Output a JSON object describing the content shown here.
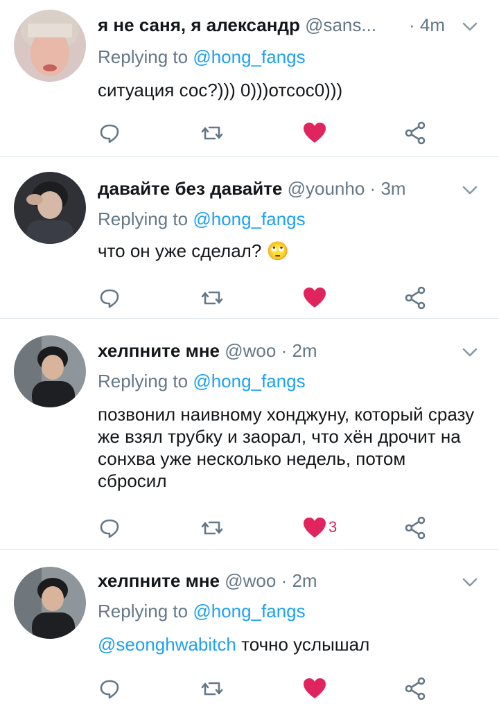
{
  "tweets": [
    {
      "name": "я не саня, я александр",
      "handle": "@sans...",
      "sep": "·",
      "time": "4m",
      "replying_prefix": "Replying to",
      "replying_to": "@hong_fangs",
      "text": "ситуация сос?))) 0)))отсос0)))",
      "likes": ""
    },
    {
      "name": "давайте без давайте",
      "handle": "@younho",
      "sep": "·",
      "time": "3m",
      "replying_prefix": "Replying to",
      "replying_to": "@hong_fangs",
      "text": "что он уже сделал?",
      "emoji": "🙄",
      "likes": ""
    },
    {
      "name": "хелпните мне",
      "handle": "@woo",
      "sep": "·",
      "time": "2m",
      "replying_prefix": "Replying to",
      "replying_to": "@hong_fangs",
      "text": "позвонил наивному хонджуну, который сразу же взял трубку и заорал, что хён дрочит на сонхва уже несколько недель, потом сбросил",
      "likes": "3"
    },
    {
      "name": "хелпните мне",
      "handle": "@woo",
      "sep": "·",
      "time": "2m",
      "replying_prefix": "Replying to",
      "replying_to": "@hong_fangs",
      "mention": "@seonghwabitch",
      "text": "точно услышал",
      "likes": ""
    }
  ],
  "icons": {
    "reply": "reply-icon",
    "retweet": "retweet-icon",
    "like": "heart-icon",
    "share": "share-icon",
    "more": "chevron-down-icon"
  },
  "colors": {
    "like": "#e0245e",
    "link": "#1da1f2",
    "muted": "#657786"
  }
}
